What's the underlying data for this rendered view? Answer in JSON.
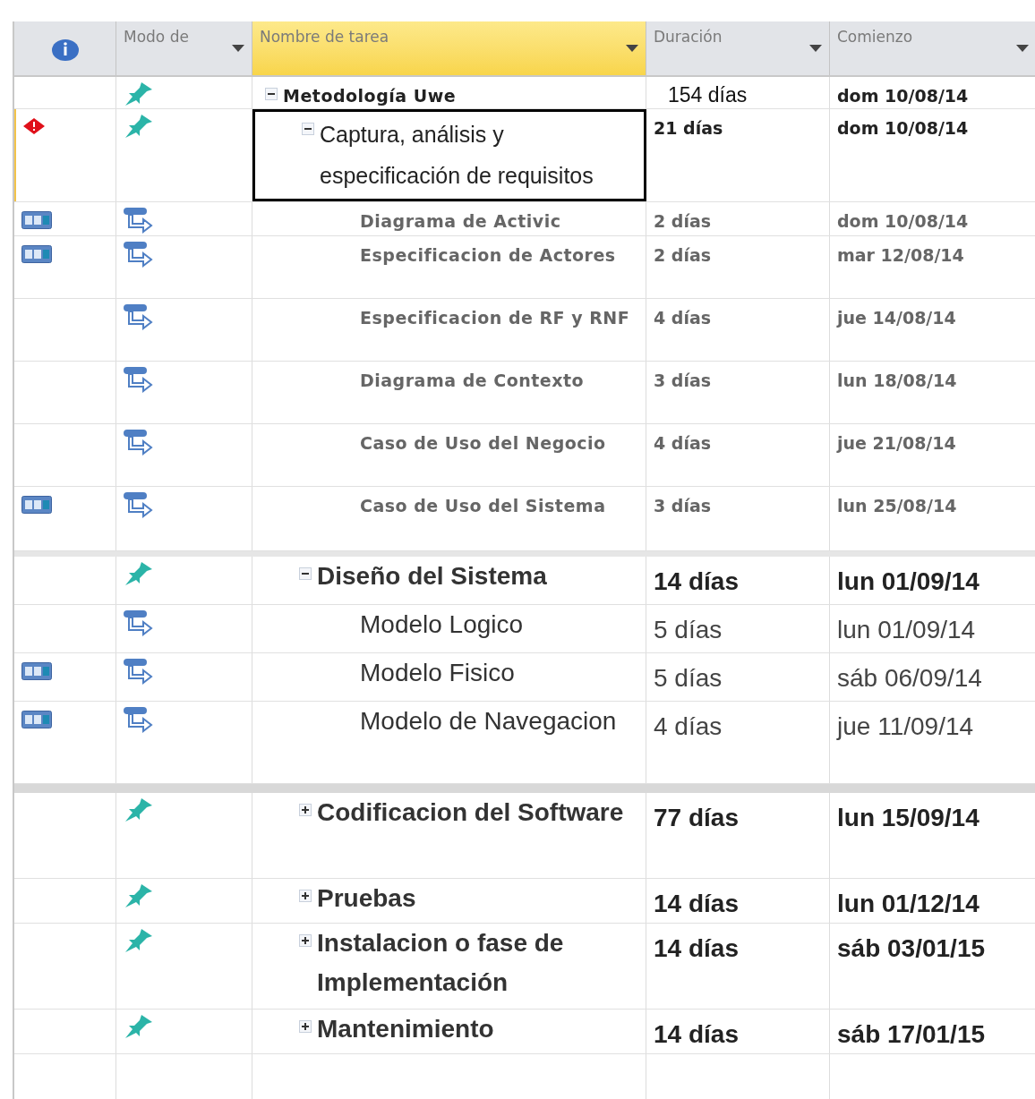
{
  "columns": [
    {
      "kind": "indicator",
      "selected": false
    },
    {
      "kind": "text",
      "label": "Modo de",
      "selected": false
    },
    {
      "kind": "text",
      "label": "Nombre de tarea",
      "selected": true
    },
    {
      "kind": "text",
      "label": "Duración",
      "selected": false
    },
    {
      "kind": "text",
      "label": "Comienzo",
      "selected": false
    }
  ],
  "tasks": [
    {
      "name": "Metodología Uwe",
      "mode": {
        "kind": "manual"
      },
      "duration": "154 días",
      "start": "dom 10/08/14",
      "selected": false,
      "expanded": true,
      "children": [
        {
          "name": "Captura, análisis y especificación de requisitos",
          "indicator": {
            "kind": "warning"
          },
          "mode": {
            "kind": "manual"
          },
          "duration": "21 días",
          "start": "dom 10/08/14",
          "selected": true,
          "expanded": true,
          "children": [
            {
              "name": "Diagrama de Activic",
              "indicator": {
                "kind": "calendar"
              },
              "mode": {
                "kind": "auto"
              },
              "duration": "2 días",
              "start": "dom 10/08/14",
              "selected": false
            },
            {
              "name": "Especificacion de Actores",
              "indicator": {
                "kind": "calendar"
              },
              "mode": {
                "kind": "auto"
              },
              "duration": "2 días",
              "start": "mar 12/08/14",
              "selected": false
            },
            {
              "name": "Especificacion de RF y RNF",
              "mode": {
                "kind": "auto"
              },
              "duration": "4 días",
              "start": "jue 14/08/14",
              "selected": false
            },
            {
              "name": "Diagrama de Contexto",
              "mode": {
                "kind": "auto"
              },
              "duration": "3 días",
              "start": "lun 18/08/14",
              "selected": false
            },
            {
              "name": "Caso de Uso del Negocio",
              "mode": {
                "kind": "auto"
              },
              "duration": "4 días",
              "start": "jue 21/08/14",
              "selected": false
            },
            {
              "name": "Caso de Uso del Sistema",
              "indicator": {
                "kind": "calendar"
              },
              "mode": {
                "kind": "auto"
              },
              "duration": "3 días",
              "start": "lun 25/08/14",
              "selected": false
            }
          ]
        },
        {
          "name": "Diseño del Sistema",
          "mode": {
            "kind": "manual"
          },
          "duration": "14 días",
          "start": "lun 01/09/14",
          "selected": false,
          "expanded": true,
          "children": [
            {
              "name": "Modelo Logico",
              "mode": {
                "kind": "auto"
              },
              "duration": "5 días",
              "start": "lun 01/09/14",
              "selected": false
            },
            {
              "name": "Modelo Fisico",
              "indicator": {
                "kind": "calendar"
              },
              "mode": {
                "kind": "auto"
              },
              "duration": "5 días",
              "start": "sáb 06/09/14",
              "selected": false
            },
            {
              "name": "Modelo de Navegacion",
              "indicator": {
                "kind": "calendar"
              },
              "mode": {
                "kind": "auto"
              },
              "duration": "4 días",
              "start": "jue 11/09/14",
              "selected": false
            }
          ]
        },
        {
          "name": "Codificacion del Software",
          "mode": {
            "kind": "manual"
          },
          "duration": "77 días",
          "start": "lun 15/09/14",
          "selected": false,
          "expanded": false
        },
        {
          "name": "Pruebas",
          "mode": {
            "kind": "manual"
          },
          "duration": "14 días",
          "start": "lun 01/12/14",
          "selected": false,
          "expanded": false
        },
        {
          "name": "Instalacion o fase de Implementación",
          "mode": {
            "kind": "manual"
          },
          "duration": "14 días",
          "start": "sáb 03/01/15",
          "selected": false,
          "expanded": false
        },
        {
          "name": "Mantenimiento",
          "mode": {
            "kind": "manual"
          },
          "duration": "14 días",
          "start": "sáb 17/01/15",
          "selected": false,
          "expanded": false
        }
      ]
    }
  ]
}
